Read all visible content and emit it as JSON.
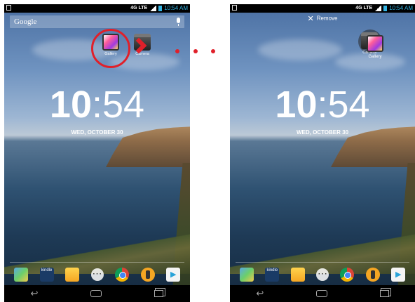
{
  "left_screen": {
    "status": {
      "network": "4G LTE",
      "time": "10:54 AM"
    },
    "search": {
      "logo": "Google"
    },
    "apps": [
      {
        "label": "Gallery"
      },
      {
        "label": "Camera"
      }
    ],
    "clock": {
      "hours": "10",
      "separator": ":",
      "minutes": "54"
    },
    "date": "WED, OCTOBER 30",
    "dock": {
      "kindle_label": "kindle"
    }
  },
  "right_screen": {
    "status": {
      "network": "4G LTE",
      "time": "10:54 AM"
    },
    "remove_label": "Remove",
    "apps": [
      {
        "label": "Camera"
      },
      {
        "label": "Gallery"
      }
    ],
    "clock": {
      "hours": "10",
      "separator": ":",
      "minutes": "54"
    },
    "date": "WED, OCTOBER 30",
    "dock": {
      "kindle_label": "kindle"
    }
  },
  "colors": {
    "accent_red": "#e0202a",
    "status_blue": "#33b5e5"
  },
  "icons": [
    "mic-icon",
    "close-icon",
    "back-icon",
    "home-icon",
    "recent-apps-icon",
    "chevron-right-icon"
  ]
}
